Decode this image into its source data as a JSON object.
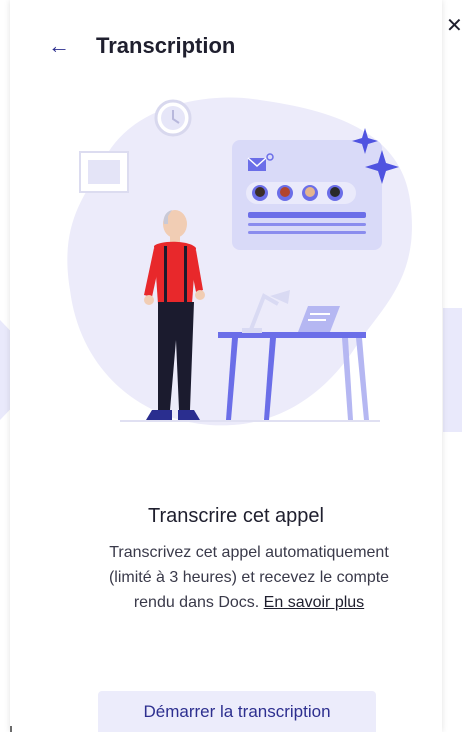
{
  "header": {
    "back_icon": "arrow-left-icon",
    "title": "Transcription",
    "close_icon": "close-icon"
  },
  "content": {
    "heading": "Transcrire cet appel",
    "description": "Transcrivez cet appel automatiquement (limité à 3 heures) et recevez le compte rendu dans Docs.",
    "learn_more": "En savoir plus"
  },
  "actions": {
    "start_label": "Démarrer la transcription"
  },
  "colors": {
    "accent": "#2d2f8f",
    "illustration_bg": "#ecebfa",
    "illustration_primary": "#6b6ee8",
    "shirt": "#e8282b"
  }
}
